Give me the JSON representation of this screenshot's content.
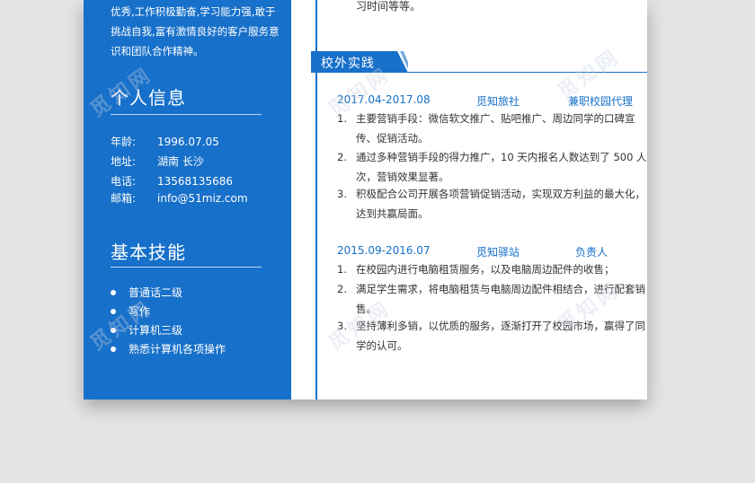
{
  "sidebar": {
    "intro": "优秀,工作积极勤奋,学习能力强,敢于挑战自我,富有激情良好的客户服务意识和团队合作精神。",
    "personal": {
      "title": "个人信息",
      "rows": [
        {
          "key": "年龄:",
          "value": "1996.07.05"
        },
        {
          "key": "地址:",
          "value": "湖南 长沙"
        },
        {
          "key": "电话:",
          "value": "13568135686"
        },
        {
          "key": "邮箱:",
          "value": "info@51miz.com"
        }
      ]
    },
    "skills": {
      "title": "基本技能",
      "items": [
        "普通话二级",
        "写作",
        "计算机三级",
        "熟悉计算机各项操作"
      ]
    }
  },
  "main": {
    "top_fragment": "习时间等等。",
    "section": {
      "title": "校外实践",
      "entries": [
        {
          "date": "2017.04-2017.08",
          "company": "觅知旅社",
          "role": "兼职校园代理",
          "items": [
            {
              "num": "1.",
              "text": "主要营销手段：微信软文推广、贴吧推广、周边同学的口碑宣传、促销活动。"
            },
            {
              "num": "2.",
              "text": "通过多种营销手段的得力推广，10 天内报名人数达到了 500 人次，营销效果显著。"
            },
            {
              "num": "3.",
              "text": "积极配合公司开展各项营销促销活动，实现双方利益的最大化，达到共赢局面。"
            }
          ]
        },
        {
          "date": "2015.09-2016.07",
          "company": "觅知驿站",
          "role": "负责人",
          "items": [
            {
              "num": "1.",
              "text": "在校园内进行电脑租赁服务，以及电脑周边配件的收售；"
            },
            {
              "num": "2.",
              "text": "满足学生需求，将电脑租赁与电脑周边配件相结合，进行配套销售。"
            },
            {
              "num": "3.",
              "text": "坚持薄利多销，以优质的服务，逐渐打开了校园市场，赢得了同学的认可。"
            }
          ]
        }
      ]
    }
  },
  "watermark": "觅知网",
  "colors": {
    "accent": "#1770c9",
    "background": "#e4e4e4",
    "paper": "#ffffff"
  }
}
